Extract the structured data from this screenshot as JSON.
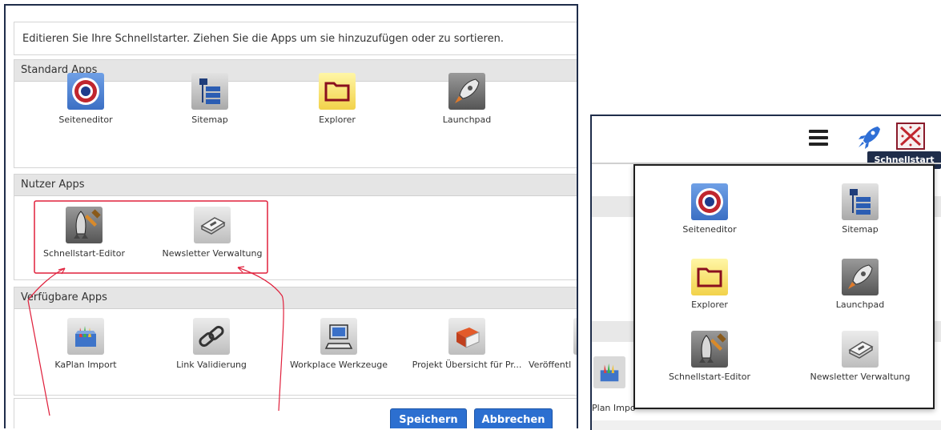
{
  "editor": {
    "instruction": "Editieren Sie Ihre Schnellstarter. Ziehen Sie die Apps um sie hinzuzufügen oder zu sortieren.",
    "sections": {
      "standard": {
        "title": "Standard Apps",
        "apps": [
          {
            "label": "Seiteneditor",
            "icon": "target-icon"
          },
          {
            "label": "Sitemap",
            "icon": "sitemap-icon"
          },
          {
            "label": "Explorer",
            "icon": "folder-icon"
          },
          {
            "label": "Launchpad",
            "icon": "rocket-icon"
          }
        ]
      },
      "user": {
        "title": "Nutzer Apps",
        "apps": [
          {
            "label": "Schnellstart-Editor",
            "icon": "rocket-hammer-icon"
          },
          {
            "label": "Newsletter Verwaltung",
            "icon": "newsletter-icon"
          }
        ]
      },
      "available": {
        "title": "Verfügbare Apps",
        "apps": [
          {
            "label": "KaPlan Import",
            "icon": "import-icon"
          },
          {
            "label": "Link Validierung",
            "icon": "link-icon"
          },
          {
            "label": "Workplace Werkzeuge",
            "icon": "computer-icon"
          },
          {
            "label": "Projekt Übersicht für Pr...",
            "icon": "book-icon"
          },
          {
            "label": "Veröffentl",
            "icon": "publish-icon"
          }
        ]
      }
    },
    "buttons": {
      "save": "Speichern",
      "cancel": "Abbrechen"
    }
  },
  "launcher": {
    "tooltip": "Schnellstart",
    "background_fragment": "Plan Impo",
    "apps": [
      {
        "label": "Seiteneditor",
        "icon": "target-icon"
      },
      {
        "label": "Sitemap",
        "icon": "sitemap-icon"
      },
      {
        "label": "Explorer",
        "icon": "folder-icon"
      },
      {
        "label": "Launchpad",
        "icon": "rocket-icon"
      },
      {
        "label": "Schnellstart-Editor",
        "icon": "rocket-hammer-icon"
      },
      {
        "label": "Newsletter Verwaltung",
        "icon": "newsletter-icon"
      }
    ]
  },
  "colors": {
    "primary_button": "#2c6fd0",
    "highlight_box": "#e0203c",
    "frame": "#1f2d4a"
  }
}
